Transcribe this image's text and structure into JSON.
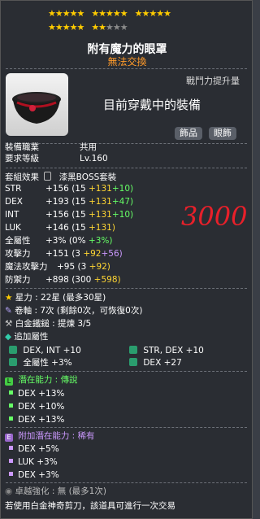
{
  "stars": {
    "rows": [
      {
        "groups": [
          "★★★★★",
          "★★★★★",
          "★★★★★"
        ],
        "off": [
          "",
          "",
          ""
        ]
      },
      {
        "groups": [
          "★★★★★",
          "★★",
          ""
        ],
        "off": [
          "",
          "★★★",
          ""
        ]
      }
    ]
  },
  "item": {
    "name": "附有魔力的眼罩",
    "trade": "無法交換",
    "combat_power_label": "戰鬥力提升量",
    "equipped_label": "目前穿戴中的裝備",
    "category": "飾品",
    "slot": "眼飾"
  },
  "info": {
    "job_label": "裝備職業",
    "job_value": "共用",
    "level_label": "要求等級",
    "level_value": "Lv.160",
    "set_label": "套組效果",
    "set_value": "漆黑BOSS套裝"
  },
  "stats": [
    {
      "name": "STR",
      "total": "+156",
      "base": "(15",
      "add": "+131",
      "extra": "+10)"
    },
    {
      "name": "DEX",
      "total": "+193",
      "base": "(15",
      "add": "+131",
      "extra": "+47)"
    },
    {
      "name": "INT",
      "total": "+156",
      "base": "(15",
      "add": "+131",
      "extra": "+10)"
    },
    {
      "name": "LUK",
      "total": "+146",
      "base": "(15",
      "add": "+131)",
      "extra": ""
    }
  ],
  "stats2": [
    {
      "name": "全屬性",
      "total": "+3%",
      "base": "(0%",
      "add": "",
      "extra": "+3%)"
    },
    {
      "name": "攻擊力",
      "total": "+151",
      "base": "(3",
      "add": "+92",
      "extra": "+56)"
    },
    {
      "name": "魔法攻擊力",
      "total": "+95",
      "base": "(3",
      "add": "+92)",
      "extra": ""
    },
    {
      "name": "防禦力",
      "total": "+898",
      "base": "(300",
      "add": "+598)",
      "extra": ""
    }
  ],
  "annotation": "3000",
  "upgrades": {
    "stars_label": "星力 : 22星 (最多30星)",
    "scroll_label": "卷軸 : 7次 (剩餘0次，可恢復0次)",
    "hammer_label": "白金鐵鎚 : 提煉 3/5",
    "extra_label": "追加屬性",
    "extra_rows": [
      {
        "left": "DEX, INT  +10",
        "right": "STR, DEX  +10"
      },
      {
        "left": "全屬性 +3%",
        "right": "DEX  +27"
      }
    ]
  },
  "potential": {
    "label": "潛在能力 : ",
    "grade": "傳說",
    "lines": [
      "DEX +13%",
      "DEX +10%",
      "DEX +13%"
    ]
  },
  "bonus_potential": {
    "label": "附加潛在能力 : ",
    "grade": "稀有",
    "lines": [
      "DEX +5%",
      "LUK +3%",
      "DEX +3%"
    ]
  },
  "footer": {
    "soul_label": "卓越強化 :  無 (最多1次)",
    "notice": "若使用白金神奇剪刀，該道具可進行一次交易"
  },
  "colors": {
    "star_on": "#ffcc00",
    "potential": "#66ff66",
    "bonus": "#cc99ff",
    "upgrade": "#ffd633",
    "trade": "#ff9a2a"
  }
}
